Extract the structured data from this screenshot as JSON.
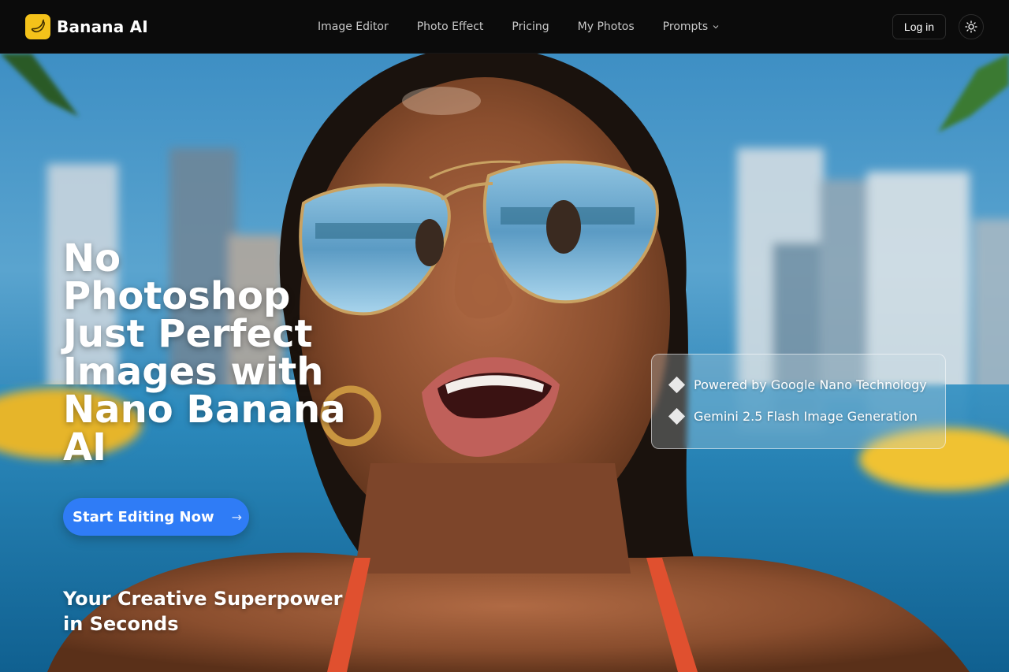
{
  "header": {
    "brand": "Banana AI",
    "login_label": "Log in",
    "nav": [
      {
        "label": "Image Editor"
      },
      {
        "label": "Photo Effect"
      },
      {
        "label": "Pricing"
      },
      {
        "label": "My Photos"
      },
      {
        "label": "Prompts",
        "dropdown": true
      }
    ]
  },
  "hero": {
    "title_lines": [
      "No",
      "Photoshop",
      "Just Perfect",
      "Images with",
      "Nano Banana",
      "AI"
    ],
    "cta_label": "Start Editing Now",
    "cta_arrow": "→",
    "subtitle_lines": [
      "Your Creative Superpower",
      "in Seconds"
    ],
    "features": [
      "Powered by Google Nano Technology",
      "Gemini 2.5 Flash Image Generation"
    ]
  },
  "colors": {
    "accent": "#2f7cf6",
    "logo": "#f4c21a",
    "header_bg": "#0b0b0b"
  },
  "icons": [
    "banana-icon",
    "chevron-down-icon",
    "sun-icon",
    "arrow-right-icon",
    "diamond-icon"
  ]
}
